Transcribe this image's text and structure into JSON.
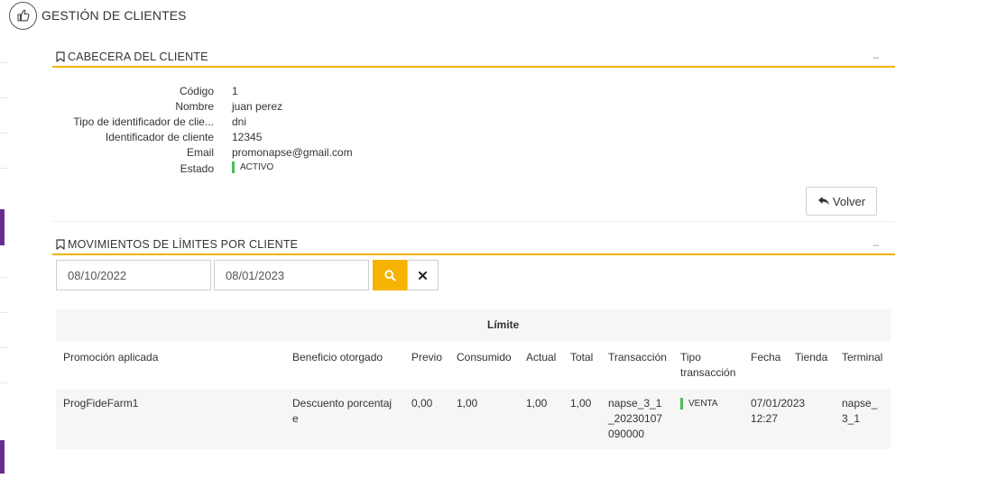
{
  "page": {
    "title": "GESTIÓN DE CLIENTES",
    "icon": "thumbs-up-icon"
  },
  "header_section": {
    "title": "CABECERA DEL CLIENTE",
    "collapse_icon": "minus-icon",
    "fields": [
      {
        "label": "Código",
        "value": "1"
      },
      {
        "label": "Nombre",
        "value": "juan perez"
      },
      {
        "label": "Tipo de identificador de clie...",
        "value": "dni"
      },
      {
        "label": "Identificador de cliente",
        "value": "12345"
      },
      {
        "label": "Email",
        "value": "promonapse@gmail.com"
      },
      {
        "label": "Estado",
        "value": "ACTIVO"
      }
    ],
    "status_color": "#4cbb5b",
    "back_button": "Volver"
  },
  "movements_section": {
    "title": "MOVIMIENTOS DE LÍMITES POR CLIENTE",
    "date_from": "08/10/2022",
    "date_to": "08/01/2023",
    "search_icon": "search-icon",
    "clear_icon": "close-icon"
  },
  "table": {
    "group_header": "Límite",
    "columns": {
      "promocion": "Promoción aplicada",
      "beneficio": "Beneficio otorgado",
      "previo": "Previo",
      "consumido": "Consumido",
      "actual": "Actual",
      "total": "Total",
      "transaccion": "Transacción",
      "tipo": "Tipo transacción",
      "fecha": "Fecha",
      "tienda": "Tienda",
      "terminal": "Terminal"
    },
    "rows": [
      {
        "promocion": "ProgFideFarm1",
        "beneficio": "Descuento porcentaje",
        "previo": "0,00",
        "consumido": "1,00",
        "actual": "1,00",
        "total": "1,00",
        "transaccion": "napse_3_1_20230107090000",
        "tipo": "VENTA",
        "fecha": "07/01/2023 12:27",
        "tienda": "",
        "terminal": "napse_3_1"
      }
    ]
  },
  "colors": {
    "accent": "#f0b400",
    "search_button": "#f6b300",
    "rail_accent": "#6a2c91"
  }
}
